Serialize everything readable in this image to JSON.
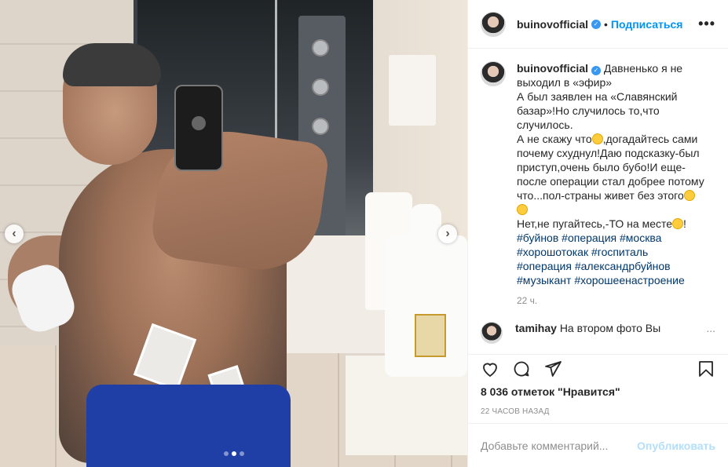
{
  "post": {
    "username": "buinovofficial",
    "follow_label": "Подписаться",
    "separator": "•",
    "more_label": "•••",
    "caption_lines": [
      "Давненько я не",
      "выходил в «эфир»",
      "А был заявлен на «Славянский",
      "базар»!Но случилось то,что",
      "случилось.",
      "А не скажу что",
      ",догадайтесь сами",
      "почему схуднул!Даю подсказку-был",
      "приступ,очень было бубо!И еще-",
      "после операции стал добрее потому",
      "что...пол-страны живет без этого",
      "Нет,не пугайтесь,-ТО на месте",
      "!"
    ],
    "hashtags": [
      "#буйнов",
      "#операция",
      "#москва",
      "#хорошотокак",
      "#госпиталь",
      "#операция",
      "#александрбуйнов",
      "#музыкант",
      "#хорошеенастроение"
    ],
    "caption_time": "22 ч.",
    "comment": {
      "username": "tamihay",
      "text": "На втором фото Вы",
      "more": "..."
    },
    "likes": "8 036 отметок \"Нравится\"",
    "timestamp": "22 ЧАСОВ НАЗАД",
    "add_comment_placeholder": "Добавьте комментарий...",
    "publish_label": "Опубликовать"
  },
  "carousel": {
    "current_index": 2,
    "total": 3,
    "prev_glyph": "‹",
    "next_glyph": "›"
  },
  "colors": {
    "accent": "#0095f6",
    "verified": "#3897f0",
    "publish_disabled": "#b2dffc",
    "hashtag": "#00376b",
    "muted": "#8e8e8e"
  },
  "icons": [
    "heart-icon",
    "comment-icon",
    "share-icon",
    "bookmark-icon",
    "verified-icon",
    "more-icon",
    "chevron-left-icon",
    "chevron-right-icon"
  ]
}
